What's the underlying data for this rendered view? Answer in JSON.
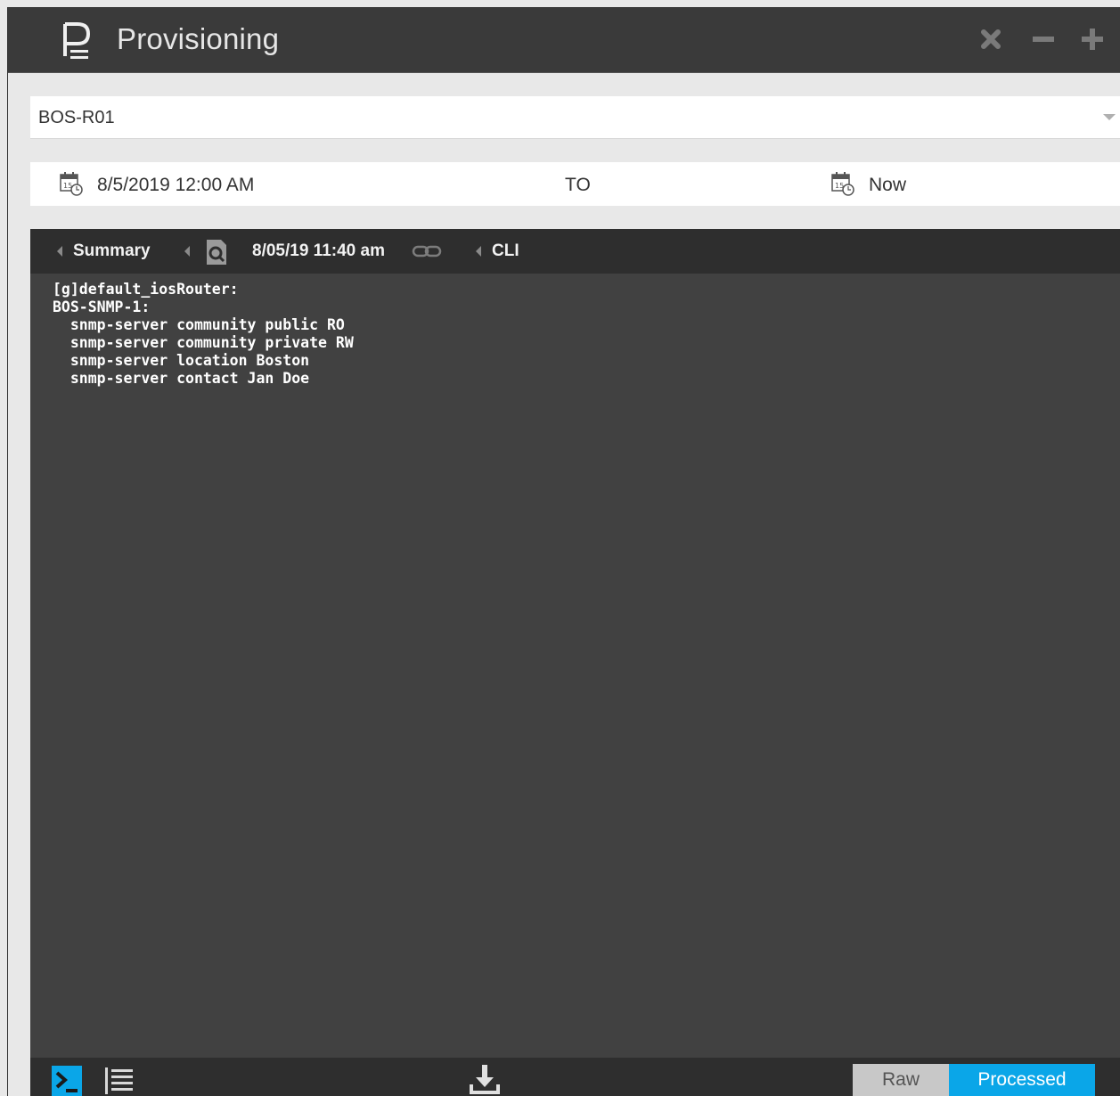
{
  "app": {
    "title": "Provisioning"
  },
  "device_selector": {
    "value": "BOS-R01"
  },
  "date_range": {
    "from": "8/5/2019 12:00 AM",
    "separator": "TO",
    "to": "Now"
  },
  "breadcrumb": {
    "summary": "Summary",
    "timestamp": "8/05/19 11:40 am",
    "cli": "CLI"
  },
  "config_lines": [
    "[g]default_iosRouter:",
    "BOS-SNMP-1:",
    "  snmp-server community public RO",
    "  snmp-server community private RW",
    "  snmp-server location Boston",
    "  snmp-server contact Jan Doe"
  ],
  "view_toggle": {
    "raw": "Raw",
    "processed": "Processed",
    "selected": "Processed"
  },
  "colors": {
    "accent": "#0aa6e8",
    "titlebar": "#3a3a3a",
    "panel": "#414141",
    "bar": "#2e2e2e"
  },
  "icons": {
    "titlebar": [
      "app-logo-icon",
      "close-icon",
      "minimize-icon",
      "maximize-icon"
    ],
    "toolbar": [
      "terminal-icon",
      "list-icon",
      "download-icon"
    ],
    "breadcrumb": [
      "search-document-icon",
      "link-icon"
    ],
    "date": [
      "calendar-clock-icon"
    ]
  }
}
